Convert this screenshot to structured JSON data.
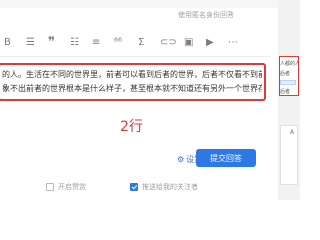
{
  "editor": {
    "anonymous_label": "使用匿名身份回答",
    "toolbar": [
      {
        "name": "bold-icon",
        "glyph": "B"
      },
      {
        "name": "heading-icon",
        "glyph": "☰"
      },
      {
        "name": "blockquote-icon",
        "glyph": "❞"
      },
      {
        "name": "bulleted-list-icon",
        "glyph": "☷"
      },
      {
        "name": "numbered-list-icon",
        "glyph": "≡"
      },
      {
        "name": "code-icon",
        "glyph": "⁶⁶"
      },
      {
        "name": "formula-icon",
        "glyph": "Σ"
      },
      {
        "name": "link-icon",
        "glyph": "⊂⊃"
      },
      {
        "name": "image-icon",
        "glyph": "▣"
      },
      {
        "name": "video-icon",
        "glyph": "▶"
      },
      {
        "name": "more-icon",
        "glyph": "⋯"
      }
    ],
    "content_lines": [
      "的人。生活在不同的世界里，前者可以看到后者的世界，后者不仅看不到前者的",
      "象不出前者的世界根本是什么样子，甚至根本就不知道还有另外一个世界存在。"
    ],
    "annotation": "2行",
    "settings_label": "设置",
    "submit_label": "提交回答",
    "options": [
      {
        "label": "开启赞赏",
        "checked": false
      },
      {
        "label": "推送给我的关注者",
        "checked": true
      }
    ],
    "accent_color": "#2c79e6",
    "highlight_color": "#d93b3b"
  },
  "side_panel": {
    "visible_text": [
      "人都的人和不",
      "后者",
      "后者"
    ],
    "caret_text": "A"
  }
}
